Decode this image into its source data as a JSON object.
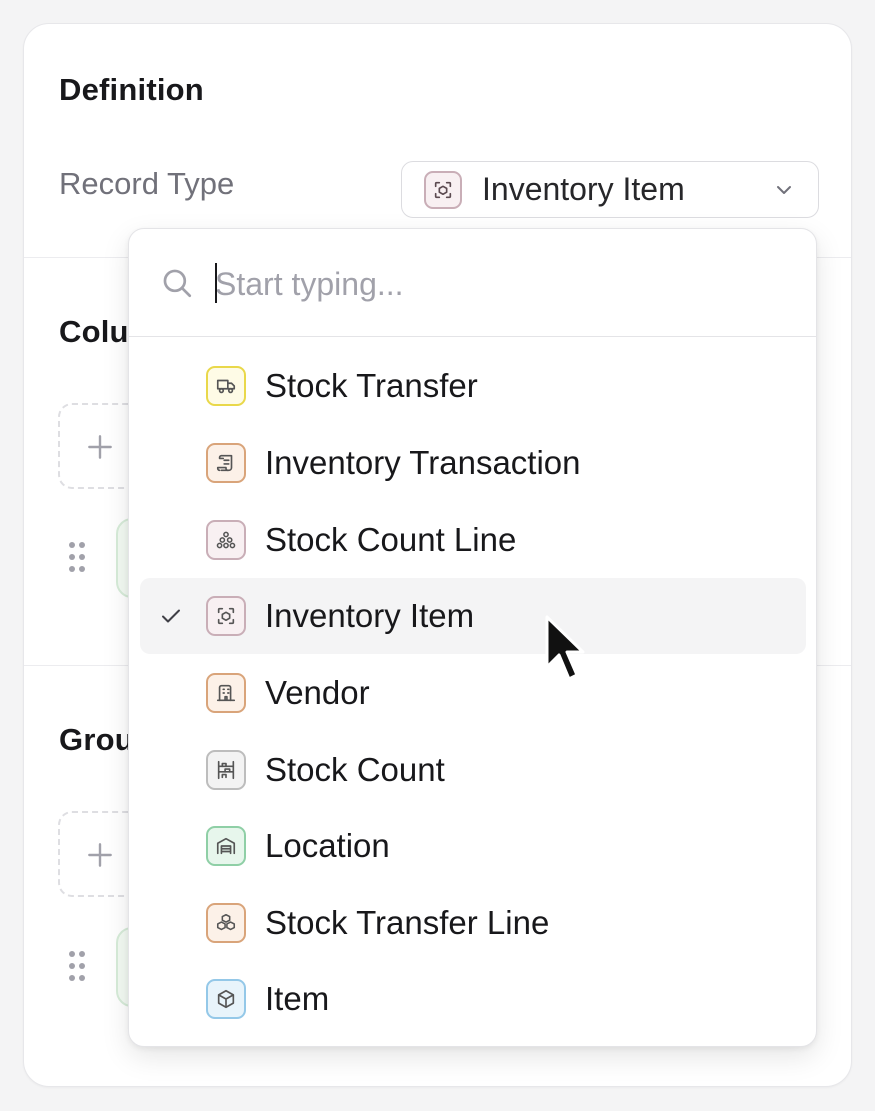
{
  "panel": {
    "definition_title": "Definition",
    "record_type_label": "Record Type",
    "columns_title_visible": "Colu",
    "group_title_visible": "Grou"
  },
  "record_type_select": {
    "value": "Inventory Item",
    "icon": "inventory-item-icon"
  },
  "dropdown": {
    "search_placeholder": "Start typing...",
    "search_value": "",
    "options": [
      {
        "label": "Stock Transfer",
        "icon": "truck-icon",
        "color": "#e9d84a",
        "bg": "#fefbe6",
        "selected": false
      },
      {
        "label": "Inventory Transaction",
        "icon": "scroll-icon",
        "color": "#d9a47a",
        "bg": "#fcf1e8",
        "selected": false
      },
      {
        "label": "Stock Count Line",
        "icon": "dots-pyramid-icon",
        "color": "#c9aeb7",
        "bg": "#f8f0f2",
        "selected": false
      },
      {
        "label": "Inventory Item",
        "icon": "scan-item-icon",
        "color": "#c9aeb7",
        "bg": "#f8f0f2",
        "selected": true
      },
      {
        "label": "Vendor",
        "icon": "building-icon",
        "color": "#d9a47a",
        "bg": "#fcf1e8",
        "selected": false
      },
      {
        "label": "Stock Count",
        "icon": "shelf-icon",
        "color": "#bdbdbd",
        "bg": "#f3f3f3",
        "selected": false
      },
      {
        "label": "Location",
        "icon": "warehouse-icon",
        "color": "#8fcfa6",
        "bg": "#e7f6ec",
        "selected": false
      },
      {
        "label": "Stock Transfer Line",
        "icon": "boxes-icon",
        "color": "#d9a47a",
        "bg": "#fcf1e8",
        "selected": false
      },
      {
        "label": "Item",
        "icon": "cube-icon",
        "color": "#94c8e8",
        "bg": "#e8f4fb",
        "selected": false
      }
    ]
  },
  "colors": {
    "text_primary": "#18181b",
    "text_muted": "#71717a",
    "selected_row_bg": "#f4f4f5"
  }
}
